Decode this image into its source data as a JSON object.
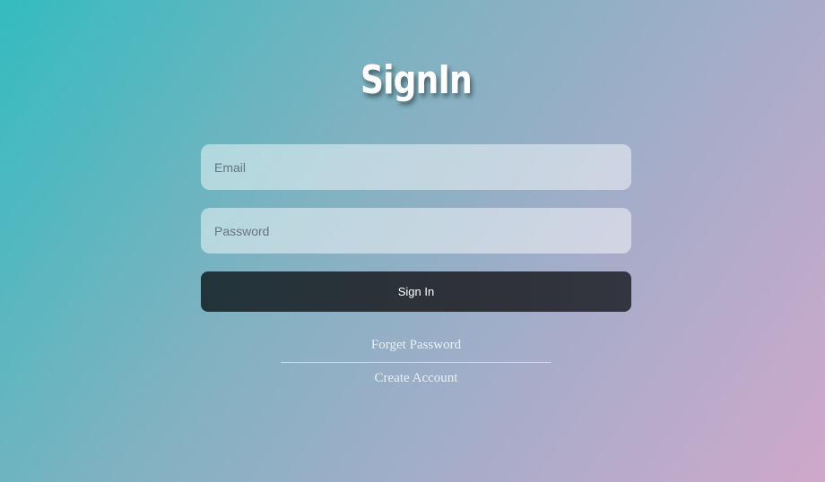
{
  "form": {
    "title": "SignIn",
    "email_placeholder": "Email",
    "password_placeholder": "Password",
    "submit_label": "Sign In"
  },
  "links": {
    "forget_password": "Forget Password",
    "create_account": "Create Account"
  },
  "colors": {
    "gradient_start": "#33bcbf",
    "gradient_end": "#cfa8cb",
    "button_bg": "#2a3237",
    "text_light": "#ffffff"
  }
}
